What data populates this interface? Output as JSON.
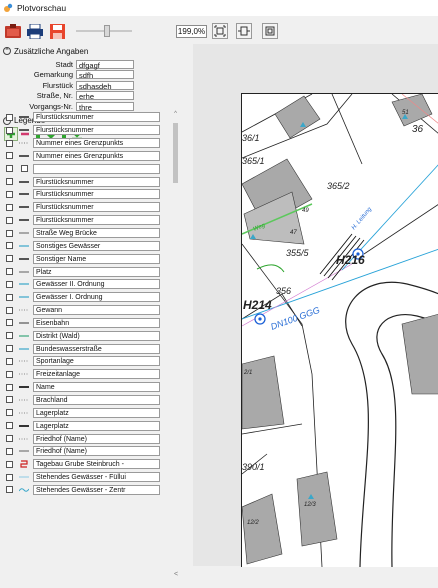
{
  "window": {
    "title": "Plotvorschau"
  },
  "toolbar": {
    "zoom": "199,0%",
    "slider_value": 0.55
  },
  "zusatz": {
    "header": "Zusätzliche Angaben",
    "fields": [
      {
        "label": "Stadt",
        "value": "dfgagf"
      },
      {
        "label": "Gemarkung",
        "value": "sdfh"
      },
      {
        "label": "Flurstück",
        "value": "sdhasdeh"
      },
      {
        "label": "Straße, Nr.",
        "value": "erhe"
      },
      {
        "label": "Vorgangs-Nr.",
        "value": "thre"
      }
    ]
  },
  "legende": {
    "header": "Legende",
    "items": [
      {
        "label": "Flurstücksnummer",
        "sym": "num",
        "color": "#555555"
      },
      {
        "label": "Flurstücksnummer",
        "sym": "num",
        "color": "#555555"
      },
      {
        "label": "Nummer eines Grenzpunkts",
        "sym": "dots",
        "color": "#777777"
      },
      {
        "label": "Nummer eines Grenzpunkts",
        "sym": "num",
        "color": "#555555"
      },
      {
        "label": "",
        "sym": "box",
        "color": "#555555"
      },
      {
        "label": "Flurstücksnummer",
        "sym": "num",
        "color": "#555555"
      },
      {
        "label": "Flurstücksnummer",
        "sym": "num",
        "color": "#555555"
      },
      {
        "label": "Flurstücksnummer",
        "sym": "num",
        "color": "#555555"
      },
      {
        "label": "Flurstücksnummer",
        "sym": "num",
        "color": "#555555"
      },
      {
        "label": "Straße Weg Brücke",
        "sym": "dash",
        "color": "#777777"
      },
      {
        "label": "Sonstiges Gewässer",
        "sym": "line",
        "color": "#3aa7c9"
      },
      {
        "label": "Sonstiger Name",
        "sym": "num",
        "color": "#555555"
      },
      {
        "label": "Platz",
        "sym": "dash",
        "color": "#777777"
      },
      {
        "label": "Gewässer II. Ordnung",
        "sym": "line",
        "color": "#3aa7c9"
      },
      {
        "label": "Gewässer I. Ordnung",
        "sym": "line",
        "color": "#3aa7c9"
      },
      {
        "label": "Gewann",
        "sym": "dots",
        "color": "#888888"
      },
      {
        "label": "Eisenbahn",
        "sym": "dash",
        "color": "#555555"
      },
      {
        "label": "Distrikt (Wald)",
        "sym": "line",
        "color": "#3aa77a"
      },
      {
        "label": "Bundeswasserstraße",
        "sym": "line",
        "color": "#3aa7c9"
      },
      {
        "label": "Sportanlage",
        "sym": "dots",
        "color": "#888888"
      },
      {
        "label": "Freizeitanlage",
        "sym": "dots",
        "color": "#888888"
      },
      {
        "label": "Name",
        "sym": "num",
        "color": "#333333"
      },
      {
        "label": "Brachland",
        "sym": "dots",
        "color": "#888888"
      },
      {
        "label": "Lagerplatz",
        "sym": "dots",
        "color": "#888888"
      },
      {
        "label": "Lagerplatz",
        "sym": "num",
        "color": "#333333"
      },
      {
        "label": "Friedhof (Name)",
        "sym": "dots",
        "color": "#888888"
      },
      {
        "label": "Friedhof (Name)",
        "sym": "dash",
        "color": "#777777"
      },
      {
        "label": "Tagebau Grube Steinbruch -",
        "sym": "red",
        "color": "#cc2222"
      },
      {
        "label": "Stehendes Gewässer - Füllui",
        "sym": "line",
        "color": "#9cd0e6"
      },
      {
        "label": "Stehendes Gewässer - Zentr",
        "sym": "wave",
        "color": "#3aa7c9"
      }
    ]
  },
  "map": {
    "labels": {
      "l361": "36/1",
      "l3651": "365/1",
      "l36": "36",
      "l3652": "365/2",
      "l3655": "355/5",
      "l49": "49",
      "l47": "47",
      "l356": "356",
      "l51": "51",
      "lH216": "H216",
      "lH214": "H214",
      "lDN": "DN100 GGG",
      "l21": "2/1",
      "l3901": "390/1",
      "l123": "12/3",
      "l122": "12/2",
      "lgreen": "Weg",
      "lblue": "H. Leitung"
    }
  }
}
